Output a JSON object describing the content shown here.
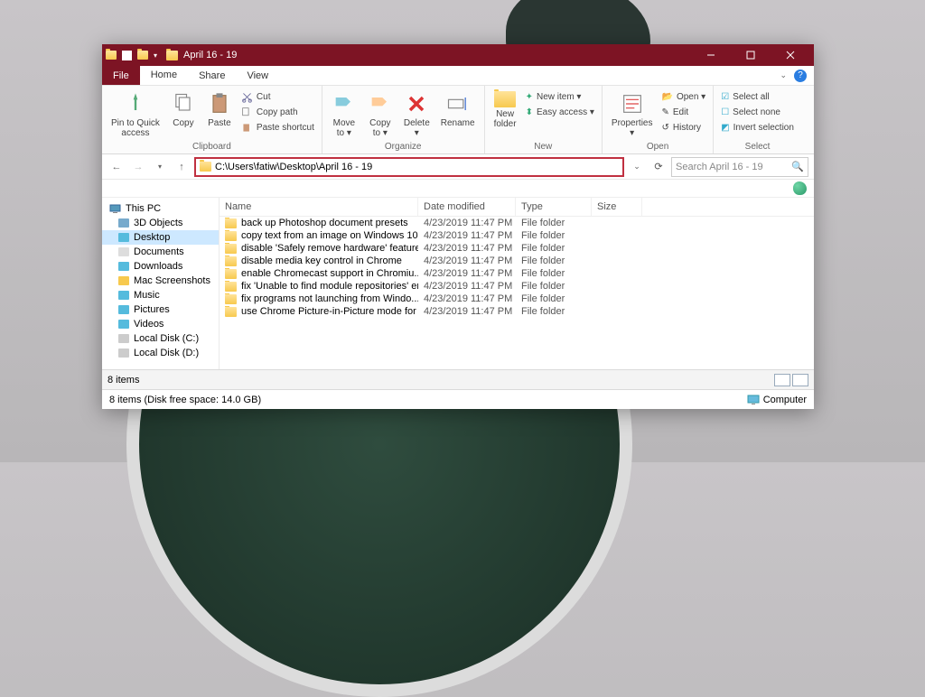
{
  "window": {
    "title": "April 16 - 19"
  },
  "menu": {
    "file": "File",
    "tabs": [
      "Home",
      "Share",
      "View"
    ]
  },
  "ribbon": {
    "clipboard": {
      "pin": "Pin to Quick\naccess",
      "copy": "Copy",
      "paste": "Paste",
      "cut": "Cut",
      "copy_path": "Copy path",
      "paste_shortcut": "Paste shortcut",
      "label": "Clipboard"
    },
    "organize": {
      "move": "Move\nto ▾",
      "copy_to": "Copy\nto ▾",
      "delete": "Delete\n▾",
      "rename": "Rename",
      "label": "Organize"
    },
    "new": {
      "folder": "New\nfolder",
      "item": "New item ▾",
      "easy": "Easy access ▾",
      "label": "New"
    },
    "open": {
      "properties": "Properties\n▾",
      "open": "Open ▾",
      "edit": "Edit",
      "history": "History",
      "label": "Open"
    },
    "select": {
      "all": "Select all",
      "none": "Select none",
      "invert": "Invert selection",
      "label": "Select"
    }
  },
  "address": {
    "path": "C:\\Users\\fatiw\\Desktop\\April 16 - 19",
    "search_placeholder": "Search April 16 - 19"
  },
  "nav": {
    "this_pc": "This PC",
    "items": [
      "3D Objects",
      "Desktop",
      "Documents",
      "Downloads",
      "Mac Screenshots",
      "Music",
      "Pictures",
      "Videos",
      "Local Disk (C:)",
      "Local Disk (D:)"
    ],
    "selected": "Desktop"
  },
  "columns": {
    "name": "Name",
    "date": "Date modified",
    "type": "Type",
    "size": "Size"
  },
  "files": [
    {
      "name": "back up Photoshop document presets",
      "date": "4/23/2019 11:47 PM",
      "type": "File folder"
    },
    {
      "name": "copy text from an image on Windows 10",
      "date": "4/23/2019 11:47 PM",
      "type": "File folder"
    },
    {
      "name": "disable 'Safely remove hardware' feature ...",
      "date": "4/23/2019 11:47 PM",
      "type": "File folder"
    },
    {
      "name": "disable media key control in Chrome",
      "date": "4/23/2019 11:47 PM",
      "type": "File folder"
    },
    {
      "name": "enable Chromecast support in Chromiu...",
      "date": "4/23/2019 11:47 PM",
      "type": "File folder"
    },
    {
      "name": "fix 'Unable to find module repositories' er...",
      "date": "4/23/2019 11:47 PM",
      "type": "File folder"
    },
    {
      "name": "fix programs not launching from Windo...",
      "date": "4/23/2019 11:47 PM",
      "type": "File folder"
    },
    {
      "name": "use Chrome Picture-in-Picture mode for ...",
      "date": "4/23/2019 11:47 PM",
      "type": "File folder"
    }
  ],
  "status": {
    "items": "8 items"
  },
  "footer": {
    "text": "8 items (Disk free space: 14.0 GB)",
    "computer": "Computer"
  }
}
